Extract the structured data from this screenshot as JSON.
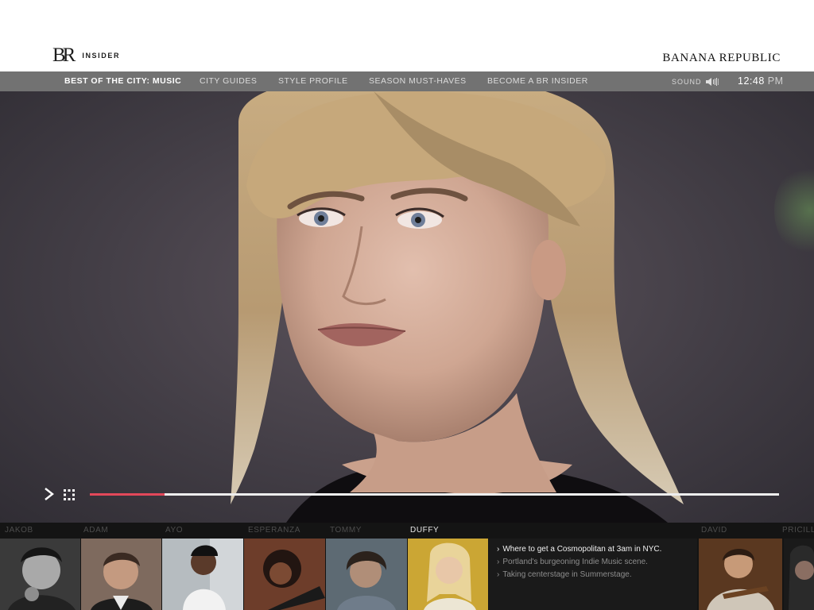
{
  "header": {
    "logo_mark": "BR",
    "logo_text": "INSIDER",
    "brand_name": "BANANA REPUBLIC"
  },
  "nav": {
    "items": [
      {
        "label": "BEST OF THE CITY: MUSIC",
        "active": true
      },
      {
        "label": "CITY GUIDES",
        "active": false
      },
      {
        "label": "STYLE PROFILE",
        "active": false
      },
      {
        "label": "SEASON MUST-HAVES",
        "active": false
      },
      {
        "label": "BECOME A BR INSIDER",
        "active": false
      }
    ],
    "sound_label": "SOUND",
    "sound_icon": "speaker-icon",
    "time": "12:48",
    "ampm": "PM"
  },
  "player": {
    "play_icon": "play-icon",
    "grid_icon": "grid-icon",
    "progress": 0.108,
    "progress_color": "#e3485a"
  },
  "artists": {
    "labels": [
      "JAKOB",
      "ADAM",
      "AYO",
      "ESPERANZA",
      "TOMMY",
      "DUFFY",
      "DAVID",
      "PRICILL"
    ],
    "active": "DUFFY",
    "info": [
      "Where to get a Cosmopolitan at 3am in NYC.",
      "Portland's burgeoning Indie Music scene.",
      "Taking centerstage in Summerstage."
    ]
  },
  "colors": {
    "nav_bg": "#727272",
    "strip_bg": "#141414",
    "accent": "#e3485a"
  }
}
